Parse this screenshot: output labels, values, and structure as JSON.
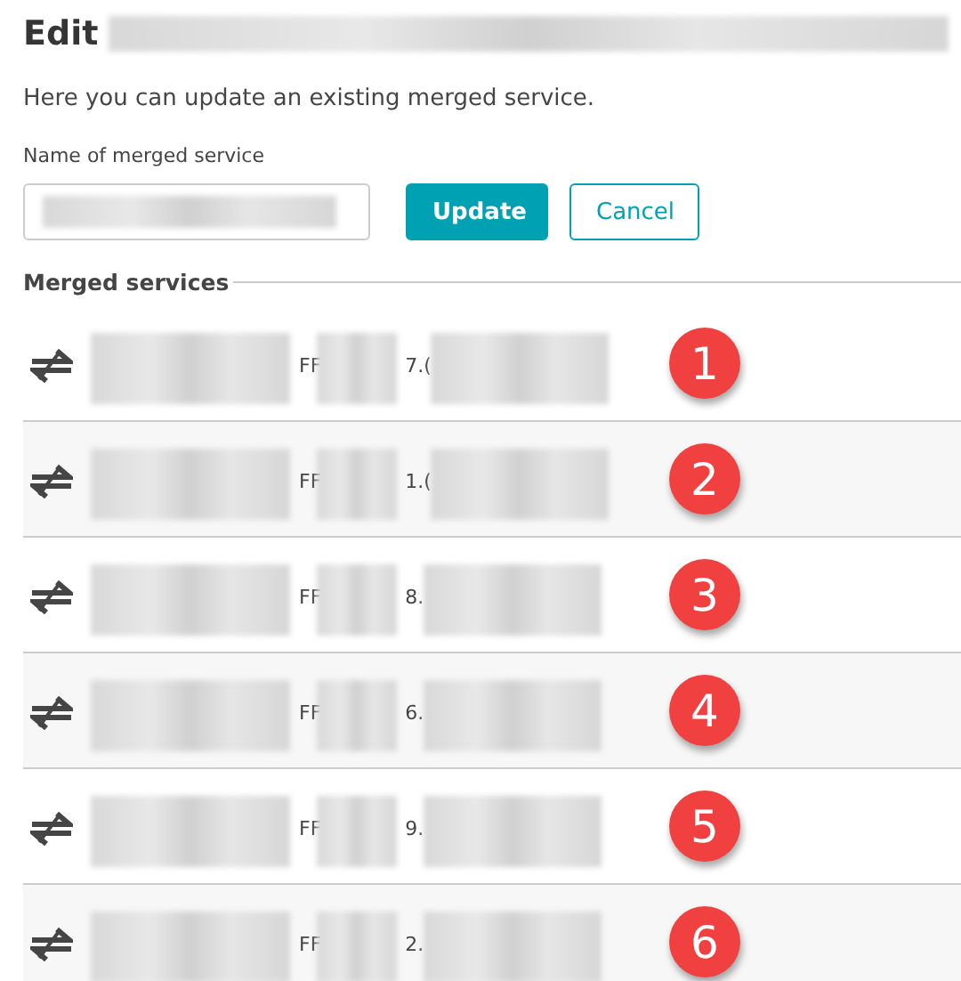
{
  "title": {
    "label": "Edit"
  },
  "description": "Here you can update an existing merged service.",
  "name_field": {
    "label": "Name of merged service"
  },
  "buttons": [
    {
      "label": "Update",
      "kind": "primary"
    },
    {
      "label": "Cancel",
      "kind": "secondary"
    }
  ],
  "section_title": "Merged services",
  "services": [
    {
      "prefix": "FF",
      "fragment": "7.(",
      "marker": "1"
    },
    {
      "prefix": "FF",
      "fragment": "1.(",
      "marker": "2"
    },
    {
      "prefix": "FF",
      "fragment": "8.",
      "marker": "3"
    },
    {
      "prefix": "FF",
      "fragment": "6.",
      "marker": "4"
    },
    {
      "prefix": "FF",
      "fragment": "9.",
      "marker": "5"
    },
    {
      "prefix": "FF",
      "fragment": "2.",
      "marker": "6"
    }
  ]
}
